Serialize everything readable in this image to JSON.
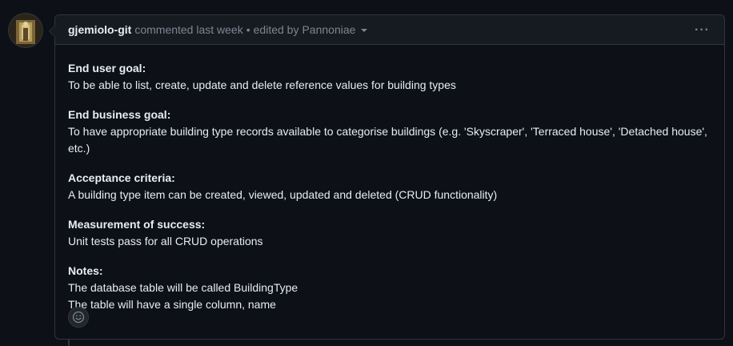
{
  "comment": {
    "author": "gjemiolo-git",
    "action": "commented last week",
    "separator": "•",
    "edited_prefix": "edited by",
    "editor": "Pannoniae",
    "menu_glyph": "···"
  },
  "sections": [
    {
      "title": "End user goal:",
      "lines": [
        "To be able to list, create, update and delete reference values for building types"
      ]
    },
    {
      "title": "End business goal:",
      "lines": [
        "To have appropriate building type records available to categorise buildings (e.g. 'Skyscraper', 'Terraced house', 'Detached house', etc.)"
      ]
    },
    {
      "title": "Acceptance criteria:",
      "lines": [
        "A building type item can be created, viewed, updated and deleted (CRUD functionality)"
      ]
    },
    {
      "title": "Measurement of success:",
      "lines": [
        "Unit tests pass for all CRUD operations"
      ]
    },
    {
      "title": "Notes:",
      "lines": [
        "The database table will be called BuildingType",
        "The table will have a single column, name"
      ]
    }
  ],
  "icons": {
    "avatar": "avatar-image",
    "caret": "chevron-down-icon",
    "kebab": "kebab-horizontal-icon",
    "reaction": "smiley-icon"
  },
  "colors": {
    "background": "#0d1117",
    "header_bg": "#161b22",
    "border": "#30363d",
    "text": "#e6edf3",
    "muted": "#7d8590"
  }
}
